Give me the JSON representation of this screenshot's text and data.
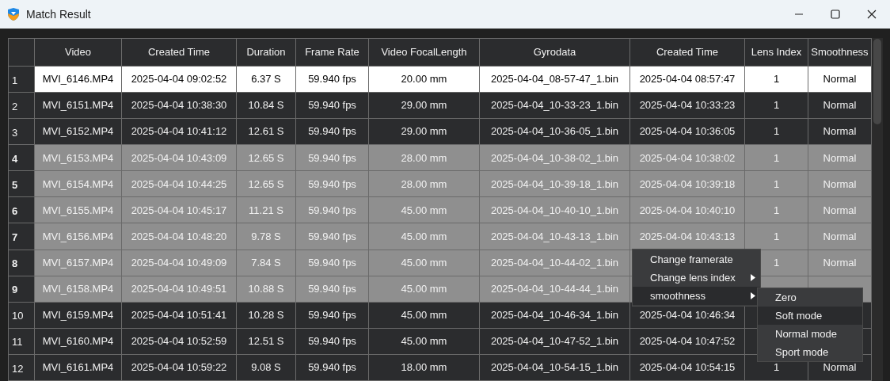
{
  "window": {
    "title": "Match Result"
  },
  "table": {
    "columns": [
      "Video",
      "Created Time",
      "Duration",
      "Frame Rate",
      "Video FocalLength",
      "Gyrodata",
      "Created Time",
      "Lens Index",
      "Smoothness"
    ],
    "rows": [
      {
        "number": "1",
        "current": true,
        "selected": false,
        "cells": [
          "MVI_6146.MP4",
          "2025-04-04 09:02:52",
          "6.37 S",
          "59.940 fps",
          "20.00 mm",
          "2025-04-04_08-57-47_1.bin",
          "2025-04-04 08:57:47",
          "1",
          "Normal"
        ]
      },
      {
        "number": "2",
        "current": false,
        "selected": false,
        "cells": [
          "MVI_6151.MP4",
          "2025-04-04 10:38:30",
          "10.84 S",
          "59.940 fps",
          "29.00 mm",
          "2025-04-04_10-33-23_1.bin",
          "2025-04-04 10:33:23",
          "1",
          "Normal"
        ]
      },
      {
        "number": "3",
        "current": false,
        "selected": false,
        "cells": [
          "MVI_6152.MP4",
          "2025-04-04 10:41:12",
          "12.61 S",
          "59.940 fps",
          "29.00 mm",
          "2025-04-04_10-36-05_1.bin",
          "2025-04-04 10:36:05",
          "1",
          "Normal"
        ]
      },
      {
        "number": "4",
        "current": false,
        "selected": true,
        "cells": [
          "MVI_6153.MP4",
          "2025-04-04 10:43:09",
          "12.65 S",
          "59.940 fps",
          "28.00 mm",
          "2025-04-04_10-38-02_1.bin",
          "2025-04-04 10:38:02",
          "1",
          "Normal"
        ]
      },
      {
        "number": "5",
        "current": false,
        "selected": true,
        "cells": [
          "MVI_6154.MP4",
          "2025-04-04 10:44:25",
          "12.65 S",
          "59.940 fps",
          "28.00 mm",
          "2025-04-04_10-39-18_1.bin",
          "2025-04-04 10:39:18",
          "1",
          "Normal"
        ]
      },
      {
        "number": "6",
        "current": false,
        "selected": true,
        "cells": [
          "MVI_6155.MP4",
          "2025-04-04 10:45:17",
          "11.21 S",
          "59.940 fps",
          "45.00 mm",
          "2025-04-04_10-40-10_1.bin",
          "2025-04-04 10:40:10",
          "1",
          "Normal"
        ]
      },
      {
        "number": "7",
        "current": false,
        "selected": true,
        "cells": [
          "MVI_6156.MP4",
          "2025-04-04 10:48:20",
          "9.78 S",
          "59.940 fps",
          "45.00 mm",
          "2025-04-04_10-43-13_1.bin",
          "2025-04-04 10:43:13",
          "1",
          "Normal"
        ]
      },
      {
        "number": "8",
        "current": false,
        "selected": true,
        "cells": [
          "MVI_6157.MP4",
          "2025-04-04 10:49:09",
          "7.84 S",
          "59.940 fps",
          "45.00 mm",
          "2025-04-04_10-44-02_1.bin",
          null,
          "1",
          "Normal"
        ]
      },
      {
        "number": "9",
        "current": false,
        "selected": true,
        "cells": [
          "MVI_6158.MP4",
          "2025-04-04 10:49:51",
          "10.88 S",
          "59.940 fps",
          "45.00 mm",
          "2025-04-04_10-44-44_1.bin",
          null,
          null,
          null
        ]
      },
      {
        "number": "10",
        "current": false,
        "selected": false,
        "cells": [
          "MVI_6159.MP4",
          "2025-04-04 10:51:41",
          "10.28 S",
          "59.940 fps",
          "45.00 mm",
          "2025-04-04_10-46-34_1.bin",
          "2025-04-04 10:46:34",
          null,
          null
        ]
      },
      {
        "number": "11",
        "current": false,
        "selected": false,
        "cells": [
          "MVI_6160.MP4",
          "2025-04-04 10:52:59",
          "12.51 S",
          "59.940 fps",
          "45.00 mm",
          "2025-04-04_10-47-52_1.bin",
          "2025-04-04 10:47:52",
          null,
          null
        ]
      },
      {
        "number": "12",
        "current": false,
        "selected": false,
        "cells": [
          "MVI_6161.MP4",
          "2025-04-04 10:59:22",
          "9.08 S",
          "59.940 fps",
          "18.00 mm",
          "2025-04-04_10-54-15_1.bin",
          "2025-04-04 10:54:15",
          "1",
          "Normal"
        ]
      }
    ]
  },
  "context_menu": {
    "items": [
      {
        "label": "Change framerate",
        "has_submenu": false,
        "highlighted": false
      },
      {
        "label": "Change lens index",
        "has_submenu": true,
        "highlighted": false
      },
      {
        "label": "smoothness",
        "has_submenu": true,
        "highlighted": true
      }
    ],
    "submenu": {
      "items": [
        {
          "label": "Zero",
          "highlighted": false
        },
        {
          "label": "Soft mode",
          "highlighted": true
        },
        {
          "label": "Normal mode",
          "highlighted": false
        },
        {
          "label": "Sport mode",
          "highlighted": false
        }
      ]
    }
  }
}
